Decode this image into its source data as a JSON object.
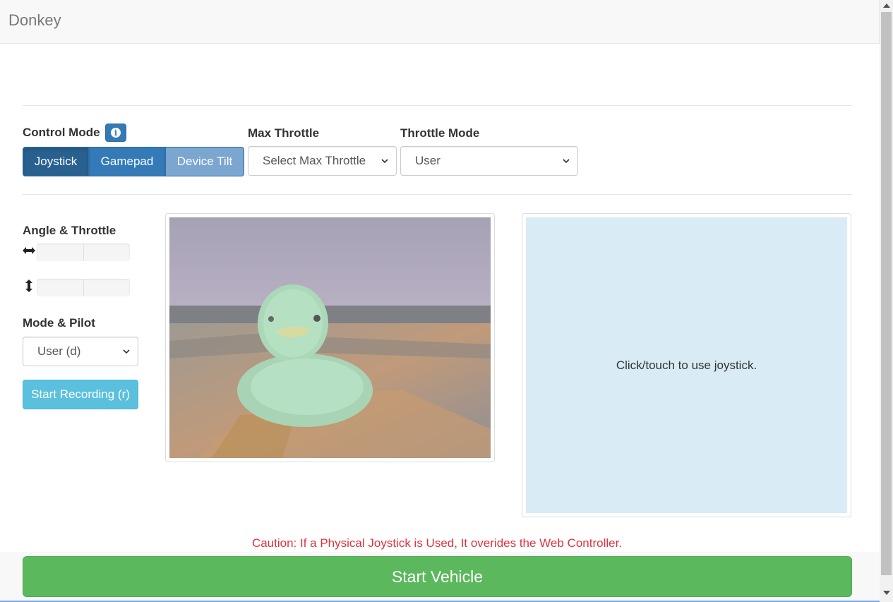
{
  "navbar": {
    "brand": "Donkey"
  },
  "controls": {
    "control_mode_label": "Control Mode",
    "control_modes": [
      "Joystick",
      "Gamepad",
      "Device Tilt"
    ],
    "selected_control_mode": "Joystick",
    "max_throttle_label": "Max Throttle",
    "max_throttle_value": "Select Max Throttle",
    "throttle_mode_label": "Throttle Mode",
    "throttle_mode_value": "User"
  },
  "left_panel": {
    "angle_throttle_label": "Angle & Throttle",
    "angle_icon": "left-right-arrow-icon",
    "throttle_icon": "up-down-arrow-icon",
    "mode_pilot_label": "Mode & Pilot",
    "mode_pilot_value": "User (d)",
    "record_button": "Start Recording (r)"
  },
  "camera": {
    "image": "rubber-duck-camera-feed"
  },
  "joystick": {
    "hint": "Click/touch to use joystick."
  },
  "caution": "Caution: If a Physical Joystick is Used, It overides the Web Controller.",
  "start_button": "Start Vehicle",
  "colors": {
    "primary": "#337ab7",
    "active": "#286090",
    "info": "#5bc0de",
    "success": "#5cb85c",
    "danger": "#e0313d",
    "joystick_bg": "#d9ebf4"
  }
}
